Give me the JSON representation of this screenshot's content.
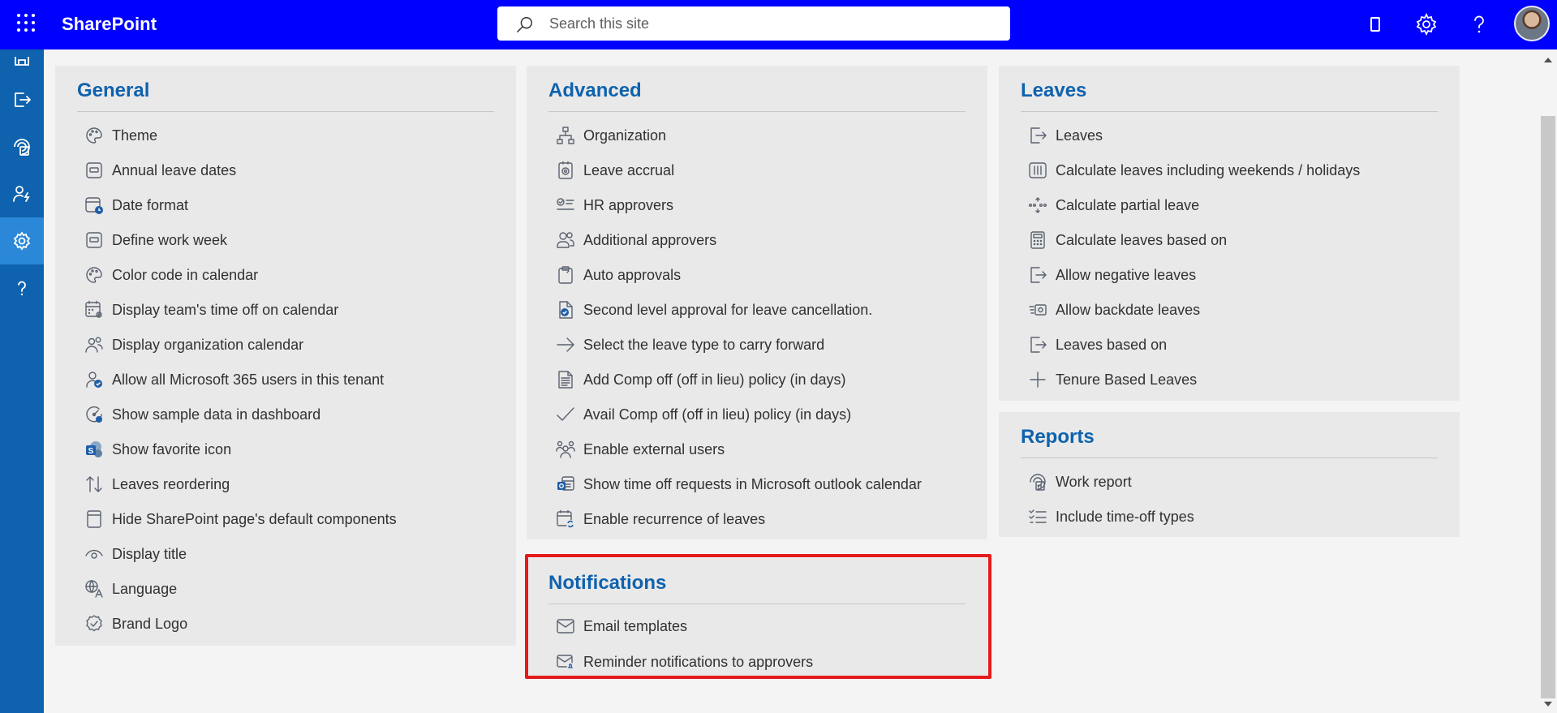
{
  "topbar": {
    "brand": "SharePoint",
    "search_placeholder": "Search this site"
  },
  "rail": {
    "items": [
      {
        "icon": "home-icon"
      },
      {
        "icon": "leave-exit-icon"
      },
      {
        "icon": "report-icon"
      },
      {
        "icon": "people-settings-icon"
      },
      {
        "icon": "settings-icon",
        "active": true
      },
      {
        "icon": "help-icon"
      }
    ]
  },
  "general": {
    "title": "General",
    "items": [
      {
        "label": "Theme",
        "icon": "palette-icon"
      },
      {
        "label": "Annual leave dates",
        "icon": "calendar-box-icon"
      },
      {
        "label": "Date format",
        "icon": "calendar-clock-icon"
      },
      {
        "label": "Define work week",
        "icon": "calendar-box-icon"
      },
      {
        "label": "Color code in calendar",
        "icon": "palette-icon"
      },
      {
        "label": "Display team's time off on calendar",
        "icon": "calendar-settings-icon"
      },
      {
        "label": "Display organization calendar",
        "icon": "people-icon"
      },
      {
        "label": "Allow all Microsoft 365 users in this tenant",
        "icon": "person-check-icon"
      },
      {
        "label": "Show sample data in dashboard",
        "icon": "gauge-icon"
      },
      {
        "label": "Show favorite icon",
        "icon": "sharepoint-favorite-icon"
      },
      {
        "label": "Leaves reordering",
        "icon": "reorder-arrows-icon"
      },
      {
        "label": "Hide SharePoint page's default components",
        "icon": "page-icon"
      },
      {
        "label": "Display title",
        "icon": "eye-icon"
      },
      {
        "label": "Language",
        "icon": "translate-icon"
      },
      {
        "label": "Brand Logo",
        "icon": "badge-check-icon"
      }
    ]
  },
  "advanced": {
    "title": "Advanced",
    "items": [
      {
        "label": "Organization",
        "icon": "org-chart-icon"
      },
      {
        "label": "Leave accrual",
        "icon": "accrual-icon"
      },
      {
        "label": "HR approvers",
        "icon": "checklist-icon"
      },
      {
        "label": "Additional approvers",
        "icon": "people-icon"
      },
      {
        "label": "Auto approvals",
        "icon": "clipboard-icon"
      },
      {
        "label": "Second level approval for leave cancellation.",
        "icon": "document-check-icon"
      },
      {
        "label": "Select the leave type to carry forward",
        "icon": "arrow-right-icon"
      },
      {
        "label": "Add Comp off (off in lieu) policy (in days)",
        "icon": "document-lines-icon"
      },
      {
        "label": "Avail Comp off (off in lieu) policy (in days)",
        "icon": "checkmark-icon"
      },
      {
        "label": "Enable external users",
        "icon": "people-community-icon"
      },
      {
        "label": "Show time off requests in Microsoft outlook calendar",
        "icon": "outlook-calendar-icon"
      },
      {
        "label": "Enable recurrence of leaves",
        "icon": "calendar-sync-icon"
      }
    ]
  },
  "leaves": {
    "title": "Leaves",
    "items": [
      {
        "label": "Leaves",
        "icon": "leave-exit-icon"
      },
      {
        "label": "Calculate leaves including weekends / holidays",
        "icon": "calendar-columns-icon"
      },
      {
        "label": "Calculate partial leave",
        "icon": "partial-icon"
      },
      {
        "label": "Calculate leaves based on",
        "icon": "calculator-icon"
      },
      {
        "label": "Allow negative leaves",
        "icon": "leave-exit-icon"
      },
      {
        "label": "Allow backdate leaves",
        "icon": "backdate-icon"
      },
      {
        "label": "Leaves based on",
        "icon": "leave-exit-icon"
      },
      {
        "label": "Tenure Based Leaves",
        "icon": "plus-icon"
      }
    ]
  },
  "reports": {
    "title": "Reports",
    "items": [
      {
        "label": "Work report",
        "icon": "report-icon"
      },
      {
        "label": "Include time-off types",
        "icon": "task-list-icon"
      }
    ]
  },
  "notifications": {
    "title": "Notifications",
    "items": [
      {
        "label": "Email templates",
        "icon": "mail-icon"
      },
      {
        "label": "Reminder notifications to approvers",
        "icon": "mail-alert-icon"
      }
    ]
  },
  "colors": {
    "topbar": "#0000ff",
    "rail": "#0f62ad",
    "rail_active": "#2b88d8",
    "section_title": "#0f62ad",
    "highlight_border": "#e51a1a"
  }
}
